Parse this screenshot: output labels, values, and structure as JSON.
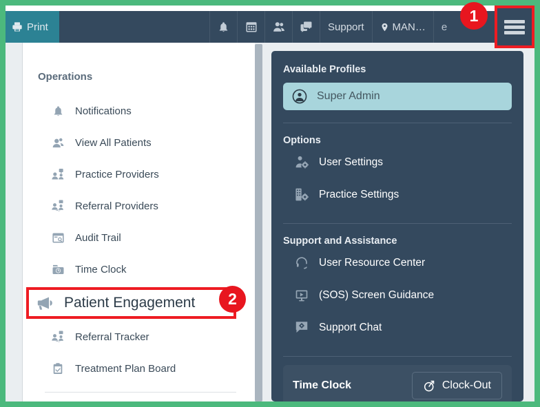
{
  "theme": {
    "page_border": "#4cb97d",
    "header_bg": "#34495e",
    "print_bg": "#2c8294",
    "panel_bg": "#34495e",
    "profile_pill": "#a8d5dc",
    "annotation_red": "#ee1c23",
    "content_bg": "#eaeef1"
  },
  "header": {
    "print_label": "Print",
    "icons": [
      {
        "name": "bell-icon",
        "title": "Notifications"
      },
      {
        "name": "calendar-icon",
        "title": "Calendar"
      },
      {
        "name": "people-icon",
        "title": "Patients"
      },
      {
        "name": "chat-icon",
        "title": "Messages"
      }
    ],
    "support_label": "Support",
    "location_label": "MAN…",
    "user_label": "e"
  },
  "annotations": [
    {
      "number": "1",
      "target": "hamburger-menu"
    },
    {
      "number": "2",
      "target": "patient-engagement"
    }
  ],
  "sidebar": {
    "title": "Operations",
    "items": [
      {
        "label": "Notifications",
        "icon": "bell-icon"
      },
      {
        "label": "View All Patients",
        "icon": "people-icon"
      },
      {
        "label": "Practice Providers",
        "icon": "provider-group-icon"
      },
      {
        "label": "Referral Providers",
        "icon": "referral-provider-icon"
      },
      {
        "label": "Audit Trail",
        "icon": "audit-search-icon"
      },
      {
        "label": "Time Clock",
        "icon": "time-clock-icon"
      }
    ],
    "highlighted": {
      "label": "Patient Engagement",
      "icon": "megaphone-icon"
    },
    "items_after": [
      {
        "label": "Referral Tracker",
        "icon": "referral-tracker-icon"
      },
      {
        "label": "Treatment Plan Board",
        "icon": "clipboard-check-icon"
      }
    ]
  },
  "profile_panel": {
    "available_profiles_title": "Available Profiles",
    "profile": {
      "label": "Super Admin",
      "icon": "user-circle-icon"
    },
    "options_title": "Options",
    "options": [
      {
        "label": "User Settings",
        "icon": "user-gear-icon"
      },
      {
        "label": "Practice Settings",
        "icon": "building-gear-icon"
      }
    ],
    "support_title": "Support and Assistance",
    "support_items": [
      {
        "label": "User Resource Center",
        "icon": "headset-icon"
      },
      {
        "label": "(SOS) Screen Guidance",
        "icon": "screen-share-icon"
      },
      {
        "label": "Support Chat",
        "icon": "chat-gear-icon"
      }
    ],
    "time_clock": {
      "label": "Time Clock",
      "button_label": "Clock-Out",
      "button_icon": "clock-arrow-icon"
    }
  }
}
